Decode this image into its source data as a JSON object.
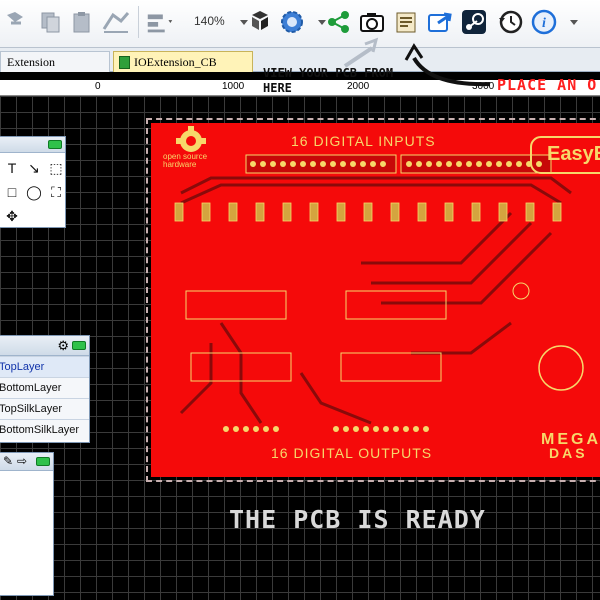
{
  "toolbar": {
    "zoom_label": "140%",
    "icons": [
      "undo-icon",
      "copy-icon",
      "paste-icon",
      "route-icon",
      "align-icon",
      "zoom-icon",
      "components-icon",
      "settings-gear-icon",
      "share-icon",
      "camera-photo-view-icon",
      "place-order-icon",
      "export-icon",
      "steam-icon",
      "history-icon",
      "help-info-icon"
    ]
  },
  "tabs": [
    {
      "label": "Extension"
    },
    {
      "label": "IOExtension_CB"
    }
  ],
  "ruler": {
    "ticks": [
      "0",
      "1000",
      "2000",
      "3000"
    ]
  },
  "annotations": {
    "view_pcb": "VIEW YOUR PCB FROM HERE",
    "place_order": "PLACE AN O",
    "ready": "THE PCB IS READY"
  },
  "board": {
    "top_label": "16 DIGITAL INPUTS",
    "bottom_label": "16 DIGITAL OUTPUTS",
    "logo_text": "open source hardware",
    "brand_text": "EasyE",
    "mega_text": "MEGA",
    "dash_text": "DAS"
  },
  "layers_panel": {
    "items": [
      {
        "label": "TopLayer",
        "active": true
      },
      {
        "label": "BottomLayer",
        "active": false
      },
      {
        "label": "TopSilkLayer",
        "active": false
      },
      {
        "label": "BottomSilkLayer",
        "active": false
      }
    ]
  },
  "colors": {
    "board_red": "#f50a0a",
    "silk_yellow": "#f7d76a",
    "trace_dark": "#8a0a0a",
    "annotation_red": "#ff2020",
    "accent_blue": "#1e6fd9"
  }
}
